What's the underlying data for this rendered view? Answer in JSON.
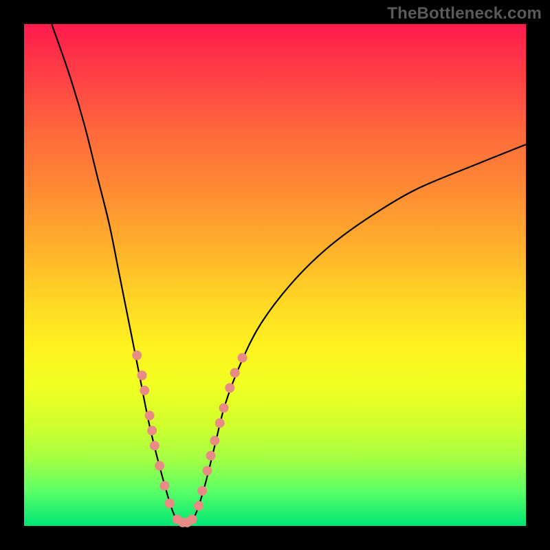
{
  "watermark": "TheBottleneck.com",
  "colors": {
    "curve": "#000000",
    "dot_fill": "#e88b85",
    "gradient_top": "#ff1a4d",
    "gradient_bottom": "#00e676",
    "background": "#000000"
  },
  "chart_data": {
    "type": "line",
    "title": "",
    "xlabel": "",
    "ylabel": "",
    "xlim": [
      0,
      100
    ],
    "ylim": [
      0,
      100
    ],
    "axes_visible": false,
    "grid": false,
    "background_gradient": "vertical red→yellow→green (bottleneck severity scale, green=0% at bottom, red=100% at top)",
    "series": [
      {
        "name": "bottleneck-left-branch",
        "points": [
          {
            "x": 5.5,
            "y": 100
          },
          {
            "x": 9,
            "y": 90
          },
          {
            "x": 12,
            "y": 80
          },
          {
            "x": 14.5,
            "y": 70
          },
          {
            "x": 17,
            "y": 60
          },
          {
            "x": 19,
            "y": 50
          },
          {
            "x": 21,
            "y": 40
          },
          {
            "x": 23,
            "y": 30
          },
          {
            "x": 25,
            "y": 20
          },
          {
            "x": 27.5,
            "y": 10
          },
          {
            "x": 30,
            "y": 2
          },
          {
            "x": 32,
            "y": 0.5
          }
        ]
      },
      {
        "name": "bottleneck-right-branch",
        "points": [
          {
            "x": 32,
            "y": 0.5
          },
          {
            "x": 34,
            "y": 2
          },
          {
            "x": 36,
            "y": 8
          },
          {
            "x": 38,
            "y": 16
          },
          {
            "x": 40,
            "y": 24
          },
          {
            "x": 43,
            "y": 32
          },
          {
            "x": 47,
            "y": 40
          },
          {
            "x": 53,
            "y": 48
          },
          {
            "x": 60,
            "y": 55
          },
          {
            "x": 68,
            "y": 61
          },
          {
            "x": 78,
            "y": 67
          },
          {
            "x": 90,
            "y": 72
          },
          {
            "x": 100,
            "y": 76
          }
        ]
      }
    ],
    "markers": {
      "name": "highlighted-points",
      "color": "#e88b85",
      "radius_px": 7,
      "points": [
        {
          "x": 22.5,
          "y": 34
        },
        {
          "x": 23.5,
          "y": 30
        },
        {
          "x": 24,
          "y": 27
        },
        {
          "x": 25,
          "y": 22
        },
        {
          "x": 25.5,
          "y": 19
        },
        {
          "x": 26,
          "y": 16
        },
        {
          "x": 27,
          "y": 12
        },
        {
          "x": 28,
          "y": 8
        },
        {
          "x": 29,
          "y": 4.5
        },
        {
          "x": 30.5,
          "y": 1.3
        },
        {
          "x": 31.6,
          "y": 0.7
        },
        {
          "x": 32.5,
          "y": 0.7
        },
        {
          "x": 33.5,
          "y": 1.3
        },
        {
          "x": 34.8,
          "y": 4
        },
        {
          "x": 35.5,
          "y": 7
        },
        {
          "x": 36.5,
          "y": 11
        },
        {
          "x": 37.2,
          "y": 14
        },
        {
          "x": 38,
          "y": 17
        },
        {
          "x": 39,
          "y": 20.5
        },
        {
          "x": 39.8,
          "y": 23.5
        },
        {
          "x": 41,
          "y": 27.5
        },
        {
          "x": 42,
          "y": 30.5
        },
        {
          "x": 43.5,
          "y": 33.5
        }
      ]
    }
  }
}
